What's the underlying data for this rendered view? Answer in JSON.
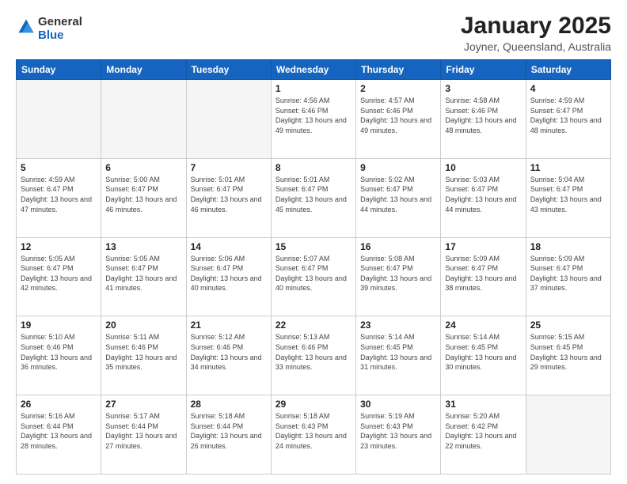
{
  "logo": {
    "general": "General",
    "blue": "Blue"
  },
  "header": {
    "title": "January 2025",
    "subtitle": "Joyner, Queensland, Australia"
  },
  "weekdays": [
    "Sunday",
    "Monday",
    "Tuesday",
    "Wednesday",
    "Thursday",
    "Friday",
    "Saturday"
  ],
  "weeks": [
    [
      {
        "day": "",
        "info": "",
        "empty": true
      },
      {
        "day": "",
        "info": "",
        "empty": true
      },
      {
        "day": "",
        "info": "",
        "empty": true
      },
      {
        "day": "1",
        "info": "Sunrise: 4:56 AM\nSunset: 6:46 PM\nDaylight: 13 hours\nand 49 minutes."
      },
      {
        "day": "2",
        "info": "Sunrise: 4:57 AM\nSunset: 6:46 PM\nDaylight: 13 hours\nand 49 minutes."
      },
      {
        "day": "3",
        "info": "Sunrise: 4:58 AM\nSunset: 6:46 PM\nDaylight: 13 hours\nand 48 minutes."
      },
      {
        "day": "4",
        "info": "Sunrise: 4:59 AM\nSunset: 6:47 PM\nDaylight: 13 hours\nand 48 minutes."
      }
    ],
    [
      {
        "day": "5",
        "info": "Sunrise: 4:59 AM\nSunset: 6:47 PM\nDaylight: 13 hours\nand 47 minutes."
      },
      {
        "day": "6",
        "info": "Sunrise: 5:00 AM\nSunset: 6:47 PM\nDaylight: 13 hours\nand 46 minutes."
      },
      {
        "day": "7",
        "info": "Sunrise: 5:01 AM\nSunset: 6:47 PM\nDaylight: 13 hours\nand 46 minutes."
      },
      {
        "day": "8",
        "info": "Sunrise: 5:01 AM\nSunset: 6:47 PM\nDaylight: 13 hours\nand 45 minutes."
      },
      {
        "day": "9",
        "info": "Sunrise: 5:02 AM\nSunset: 6:47 PM\nDaylight: 13 hours\nand 44 minutes."
      },
      {
        "day": "10",
        "info": "Sunrise: 5:03 AM\nSunset: 6:47 PM\nDaylight: 13 hours\nand 44 minutes."
      },
      {
        "day": "11",
        "info": "Sunrise: 5:04 AM\nSunset: 6:47 PM\nDaylight: 13 hours\nand 43 minutes."
      }
    ],
    [
      {
        "day": "12",
        "info": "Sunrise: 5:05 AM\nSunset: 6:47 PM\nDaylight: 13 hours\nand 42 minutes."
      },
      {
        "day": "13",
        "info": "Sunrise: 5:05 AM\nSunset: 6:47 PM\nDaylight: 13 hours\nand 41 minutes."
      },
      {
        "day": "14",
        "info": "Sunrise: 5:06 AM\nSunset: 6:47 PM\nDaylight: 13 hours\nand 40 minutes."
      },
      {
        "day": "15",
        "info": "Sunrise: 5:07 AM\nSunset: 6:47 PM\nDaylight: 13 hours\nand 40 minutes."
      },
      {
        "day": "16",
        "info": "Sunrise: 5:08 AM\nSunset: 6:47 PM\nDaylight: 13 hours\nand 39 minutes."
      },
      {
        "day": "17",
        "info": "Sunrise: 5:09 AM\nSunset: 6:47 PM\nDaylight: 13 hours\nand 38 minutes."
      },
      {
        "day": "18",
        "info": "Sunrise: 5:09 AM\nSunset: 6:47 PM\nDaylight: 13 hours\nand 37 minutes."
      }
    ],
    [
      {
        "day": "19",
        "info": "Sunrise: 5:10 AM\nSunset: 6:46 PM\nDaylight: 13 hours\nand 36 minutes."
      },
      {
        "day": "20",
        "info": "Sunrise: 5:11 AM\nSunset: 6:46 PM\nDaylight: 13 hours\nand 35 minutes."
      },
      {
        "day": "21",
        "info": "Sunrise: 5:12 AM\nSunset: 6:46 PM\nDaylight: 13 hours\nand 34 minutes."
      },
      {
        "day": "22",
        "info": "Sunrise: 5:13 AM\nSunset: 6:46 PM\nDaylight: 13 hours\nand 33 minutes."
      },
      {
        "day": "23",
        "info": "Sunrise: 5:14 AM\nSunset: 6:45 PM\nDaylight: 13 hours\nand 31 minutes."
      },
      {
        "day": "24",
        "info": "Sunrise: 5:14 AM\nSunset: 6:45 PM\nDaylight: 13 hours\nand 30 minutes."
      },
      {
        "day": "25",
        "info": "Sunrise: 5:15 AM\nSunset: 6:45 PM\nDaylight: 13 hours\nand 29 minutes."
      }
    ],
    [
      {
        "day": "26",
        "info": "Sunrise: 5:16 AM\nSunset: 6:44 PM\nDaylight: 13 hours\nand 28 minutes."
      },
      {
        "day": "27",
        "info": "Sunrise: 5:17 AM\nSunset: 6:44 PM\nDaylight: 13 hours\nand 27 minutes."
      },
      {
        "day": "28",
        "info": "Sunrise: 5:18 AM\nSunset: 6:44 PM\nDaylight: 13 hours\nand 26 minutes."
      },
      {
        "day": "29",
        "info": "Sunrise: 5:18 AM\nSunset: 6:43 PM\nDaylight: 13 hours\nand 24 minutes."
      },
      {
        "day": "30",
        "info": "Sunrise: 5:19 AM\nSunset: 6:43 PM\nDaylight: 13 hours\nand 23 minutes."
      },
      {
        "day": "31",
        "info": "Sunrise: 5:20 AM\nSunset: 6:42 PM\nDaylight: 13 hours\nand 22 minutes."
      },
      {
        "day": "",
        "info": "",
        "empty": true
      }
    ]
  ]
}
